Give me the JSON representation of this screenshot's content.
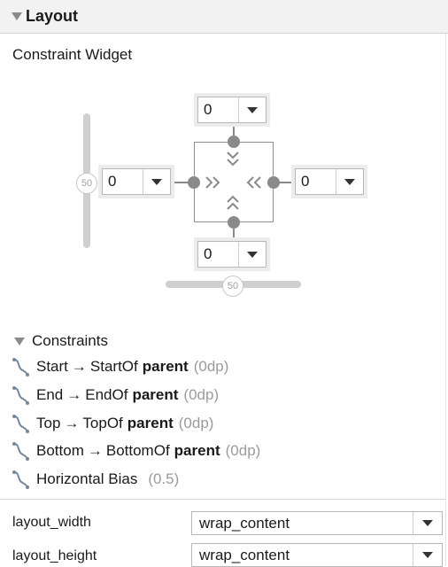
{
  "panel": {
    "title": "Layout"
  },
  "widget": {
    "title": "Constraint Widget",
    "margins": {
      "top": "0",
      "left": "0",
      "right": "0",
      "bottom": "0"
    },
    "vertical_bias": "50",
    "horizontal_bias": "50"
  },
  "constraints": {
    "header": "Constraints",
    "arrow": "→",
    "rows": [
      {
        "side": "Start",
        "target": "StartOf",
        "ref": "parent",
        "value": "(0dp)"
      },
      {
        "side": "End",
        "target": "EndOf",
        "ref": "parent",
        "value": "(0dp)"
      },
      {
        "side": "Top",
        "target": "TopOf",
        "ref": "parent",
        "value": "(0dp)"
      },
      {
        "side": "Bottom",
        "target": "BottomOf",
        "ref": "parent",
        "value": "(0dp)"
      }
    ],
    "bias": {
      "label": "Horizontal Bias",
      "value": "(0.5)"
    }
  },
  "properties": [
    {
      "label": "layout_width",
      "value": "wrap_content"
    },
    {
      "label": "layout_height",
      "value": "wrap_content"
    }
  ],
  "colors": {
    "accent": "#8a8a8a",
    "header_bg": "#f2f2f2"
  },
  "icons": {
    "constraint_row": "constraint-link-icon",
    "collapse": "triangle-down-icon",
    "dropdown": "caret-down-icon"
  }
}
